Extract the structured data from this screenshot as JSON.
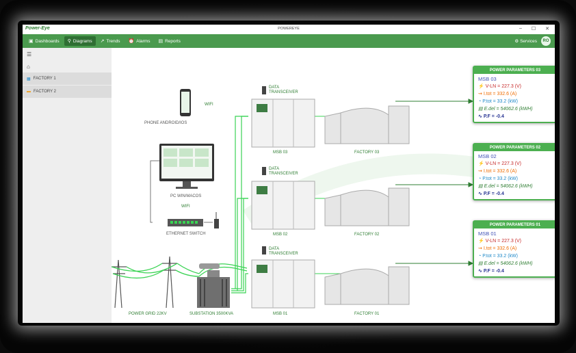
{
  "window": {
    "brand": "Power-Eye",
    "title": "POWEREYE",
    "controls": [
      "–",
      "☐",
      "✕"
    ]
  },
  "nav": {
    "items": [
      {
        "label": "Dashboards",
        "icon": "▣"
      },
      {
        "label": "Diagrams",
        "icon": "⚲"
      },
      {
        "label": "Trends",
        "icon": "↗"
      },
      {
        "label": "Alarms",
        "icon": "⏰"
      },
      {
        "label": "Reports",
        "icon": "▤"
      }
    ],
    "services": "Services",
    "avatar": "RO"
  },
  "sidebar": {
    "menu_icon": "☰",
    "home_icon": "⌂",
    "items": [
      {
        "label": "FACTORY 1",
        "icon": "▦"
      },
      {
        "label": "FACTORY 2",
        "icon": "▬"
      }
    ]
  },
  "diagram": {
    "phone": "PHONE ANDROID/IOS",
    "phone_wifi": "WIFI",
    "pc": "PC WIN/MACOS",
    "wifi": "WIFI",
    "switch": "ETHERNET SWITCH",
    "grid": "POWER GRID 22KV",
    "substation": "SUBSTATION 3500KVA",
    "transceiver": [
      "DATA",
      "TRANSCEIVER"
    ],
    "msb": [
      "MSB 03",
      "MSB 02",
      "MSB 01"
    ],
    "factories": [
      "FACTORY 03",
      "FACTORY 02",
      "FACTORY 01"
    ]
  },
  "panels": [
    {
      "title": "POWER PARAMETERS 03",
      "msb": "MSB 03",
      "vln": "V-LN = 227.3 (V)",
      "itot": "I.tot = 332.6 (A)",
      "ptot": "P.tot = 33.2 (kW)",
      "edel": "E.del = 54062.6 (kWH)",
      "pf": "P.F = -0.4"
    },
    {
      "title": "POWER PARAMETERS 02",
      "msb": "MSB 02",
      "vln": "V-LN = 227.3 (V)",
      "itot": "I.tot = 332.6 (A)",
      "ptot": "P.tot = 33.2 (kW)",
      "edel": "E.del = 54062.6 (kWH)",
      "pf": "P.F = -0.4"
    },
    {
      "title": "POWER PARAMETERS 01",
      "msb": "MSB 01",
      "vln": "V-LN = 227.3 (V)",
      "itot": "I.tot = 332.6 (A)",
      "ptot": "P.tot = 33.2 (kW)",
      "edel": "E.del = 54062.6 (kWH)",
      "pf": "P.F = -0.4"
    }
  ],
  "colors": {
    "accent": "#4a9a4e",
    "line": "#39d353",
    "panel_border": "#4caf50"
  }
}
